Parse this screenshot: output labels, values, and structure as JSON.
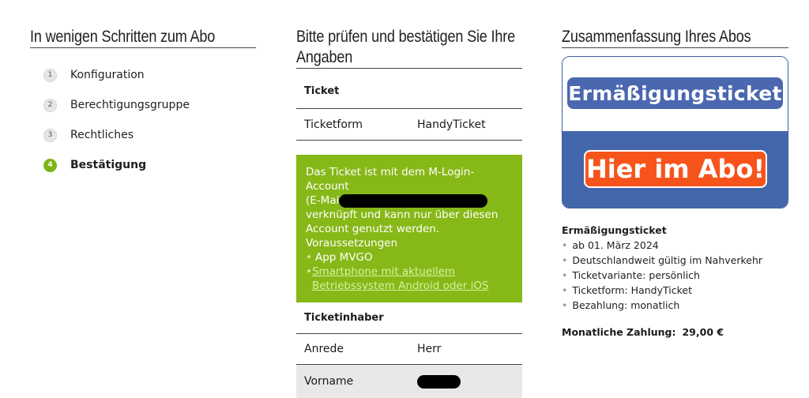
{
  "steps": {
    "title": "In wenigen Schritten zum Abo",
    "items": [
      {
        "num": "1",
        "label": "Konfiguration"
      },
      {
        "num": "2",
        "label": "Berechtigungsgruppe"
      },
      {
        "num": "3",
        "label": "Rechtliches"
      },
      {
        "num": "4",
        "label": "Bestätigung"
      }
    ]
  },
  "review": {
    "title": "Bitte prüfen und bestätigen Sie Ihre Angaben",
    "ticket_section": "Ticket",
    "ticketform_key": "Ticketform",
    "ticketform_value": "HandyTicket",
    "info_line1": "Das Ticket ist mit dem M-Login-Account",
    "info_line2": "(E-Mail",
    "info_line3": "verknüpft und kann nur über diesen",
    "info_line4": "Account genutzt werden.",
    "requirements_title": "Voraussetzungen",
    "req1": "App MVGO",
    "req2_link": "Smartphone mit aktuellem Betriebssystem Android oder iOS",
    "holder_section": "Ticketinhaber",
    "anrede_key": "Anrede",
    "anrede_value": "Herr",
    "vorname_key": "Vorname"
  },
  "summary": {
    "title": "Zusammenfassung Ihres Abos",
    "banner_top": "Ermäßigungsticket",
    "banner_bottom": "Hier im Abo!",
    "product_name": "Ermäßigungsticket",
    "details": [
      "ab 01. März 2024",
      "Deutschlandweit gültig im Nahverkehr",
      "Ticketvariante: persönlich",
      "Ticketform: HandyTicket",
      "Bezahlung: monatlich"
    ],
    "payment_label": "Monatliche Zahlung:",
    "payment_amount": "29,00 €"
  },
  "colors": {
    "accent_green": "#86b817",
    "step_active": "#7cb518",
    "banner_blue": "#4466aa",
    "banner_orange": "#f7541c"
  }
}
